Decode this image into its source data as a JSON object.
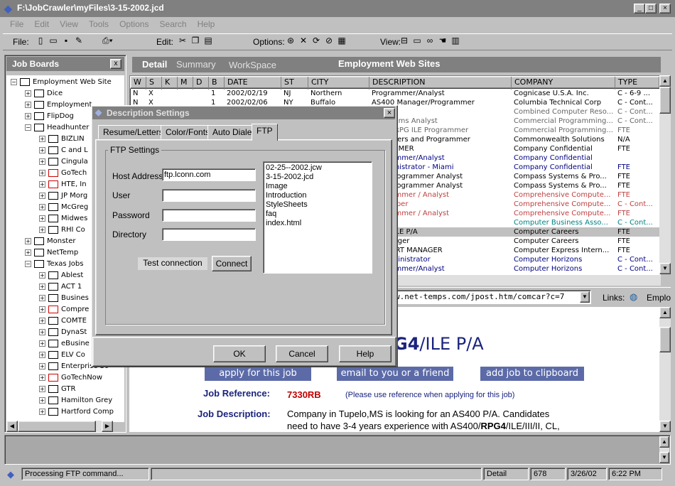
{
  "window": {
    "title": "F:\\JobCrawler\\myFiles\\3-15-2002.jcd"
  },
  "menu": [
    "File",
    "Edit",
    "View",
    "Tools",
    "Options",
    "Search",
    "Help"
  ],
  "toolbar": {
    "file": "File:",
    "edit": "Edit:",
    "options": "Options:",
    "view": "View:"
  },
  "left_panel": {
    "title": "Job Boards",
    "close": "x",
    "tree": [
      {
        "label": "Employment Web Site",
        "level": 0,
        "type": "root"
      },
      {
        "label": "Dice",
        "level": 1
      },
      {
        "label": "Employment",
        "level": 1
      },
      {
        "label": "FlipDog",
        "level": 1
      },
      {
        "label": "Headhunter",
        "level": 1
      },
      {
        "label": "BIZLIN",
        "level": 2
      },
      {
        "label": "C and L",
        "level": 2
      },
      {
        "label": "Cingula",
        "level": 2
      },
      {
        "label": "GoTech",
        "level": 2,
        "red": true
      },
      {
        "label": "HTE, In",
        "level": 2,
        "red": true
      },
      {
        "label": "JP Morg",
        "level": 2
      },
      {
        "label": "McGreg",
        "level": 2
      },
      {
        "label": "Midwes",
        "level": 2
      },
      {
        "label": "RHI Co",
        "level": 2
      },
      {
        "label": "Monster",
        "level": 1
      },
      {
        "label": "NetTemp",
        "level": 1
      },
      {
        "label": "Texas Jobs",
        "level": 1
      },
      {
        "label": "Ablest",
        "level": 2
      },
      {
        "label": "ACT 1",
        "level": 2
      },
      {
        "label": "Busines",
        "level": 2
      },
      {
        "label": "Compre",
        "level": 2,
        "red": true
      },
      {
        "label": "COMTE",
        "level": 2
      },
      {
        "label": "DynaSt",
        "level": 2
      },
      {
        "label": "eBusine",
        "level": 2
      },
      {
        "label": "ELV Co",
        "level": 2
      },
      {
        "label": "Enterprise So",
        "level": 2
      },
      {
        "label": "GoTechNow",
        "level": 2,
        "red": true
      },
      {
        "label": "GTR",
        "level": 2
      },
      {
        "label": "Hamilton Grey",
        "level": 2
      },
      {
        "label": "Hartford Comp",
        "level": 2
      }
    ]
  },
  "tabs": {
    "detail": "Detail",
    "summary": "Summary",
    "workspace": "WorkSpace",
    "section_title": "Employment Web Sites"
  },
  "grid": {
    "columns": [
      "W",
      "S",
      "K",
      "M",
      "D",
      "B",
      "DATE",
      "ST",
      "CITY",
      "DESCRIPTION",
      "COMPANY",
      "TYPE"
    ],
    "rows": [
      {
        "w": "N",
        "s": "X",
        "b": "1",
        "date": "2002/02/19",
        "st": "NJ",
        "city": "Northern",
        "desc": "Programmer/Analyst",
        "company": "Cognicase U.S.A. Inc.",
        "type": "C - 6-9 ...",
        "style": ""
      },
      {
        "w": "N",
        "s": "X",
        "b": "1",
        "date": "2002/02/06",
        "st": "NY",
        "city": "Buffalo",
        "desc": "AS400 Manager/Programmer",
        "company": "Columbia Technical Corp",
        "type": "C - Cont...",
        "style": ""
      },
      {
        "desc": "mer",
        "company": "Combined Computer Reso...",
        "type": "C - Cont...",
        "style": "gray"
      },
      {
        "desc": "B Systems Analyst",
        "company": "Commercial Programming...",
        "type": "C - Cont...",
        "style": "gray"
      },
      {
        "desc": "S/400 RPG ILE Programmer",
        "company": "Commercial Programming...",
        "type": "FTE",
        "style": "gray"
      },
      {
        "desc": "grammers and Programmer",
        "company": "Commonwealth Solutions",
        "type": "N/A",
        "style": ""
      },
      {
        "desc": "OGRAMMER",
        "company": "Company Confidential",
        "type": "FTE",
        "style": ""
      },
      {
        "desc": "Programmer/Analyst",
        "company": "Company Confidential",
        "type": "",
        "style": "blue"
      },
      {
        "desc": "r Administrator - Miami",
        "company": "Company Confidential",
        "type": "FTE",
        "style": "blue"
      },
      {
        "desc": "/400 Programmer Analyst",
        "company": "Compass Systems & Pro...",
        "type": "FTE",
        "style": ""
      },
      {
        "desc": "/400 Programmer Analyst",
        "company": "Compass Systems & Pro...",
        "type": "FTE",
        "style": ""
      },
      {
        "desc": "Programmer / Analyst",
        "company": "Comprehensive Compute...",
        "type": "FTE",
        "style": "red"
      },
      {
        "desc": "Developer",
        "company": "Comprehensive Compute...",
        "type": "C - Cont...",
        "style": "red"
      },
      {
        "desc": "Programmer / Analyst",
        "company": "Comprehensive Compute...",
        "type": "FTE",
        "style": "red"
      },
      {
        "desc": "n Lead",
        "company": "Computer Business Asso...",
        "type": "C - Cont...",
        "style": "teal"
      },
      {
        "desc": "RPG4/ILE P/A",
        "company": "Computer Careers",
        "type": "FTE",
        "style": "sel"
      },
      {
        "desc": "S Manager",
        "company": "Computer Careers",
        "type": "FTE",
        "style": ""
      },
      {
        "desc": "SUPPORT MANAGER",
        "company": "Computer Express Intern...",
        "type": "FTE",
        "style": ""
      },
      {
        "desc": "se Administrator",
        "company": "Computer Horizons",
        "type": "C - Cont...",
        "style": "blue"
      },
      {
        "desc": "Programmer/Analyst",
        "company": "Computer Horizons",
        "type": "C - Cont...",
        "style": "blue"
      }
    ]
  },
  "address": {
    "url": "w.net-temps.com/jpost.htm/comcar?c=7",
    "links": "Links:",
    "emplo": "Emplo"
  },
  "web": {
    "heading_bold": "G4",
    "heading_rest": "/ILE P/A",
    "apply": "apply for this job",
    "email": "email to you or a friend",
    "clip": "add job to clipboard",
    "ref_label": "Job Reference:",
    "ref_value": "7330RB",
    "ref_note": "(Please use reference when applying for this job)",
    "desc_label": "Job Description:",
    "desc_line1": "Company in Tupelo,MS is looking for an AS400 P/A. Candidates",
    "desc_line2a": "need to have 3-4 years experience with AS400/",
    "desc_line2b": "RPG4",
    "desc_line2c": "/ILE/III/II, CL,"
  },
  "dialog": {
    "title": "Description Settings",
    "tabs": [
      "Resume/Letters",
      "Color/Fonts",
      "Auto Dialer",
      "FTP"
    ],
    "group": "FTP Settings",
    "host_label": "Host Address",
    "host_value": "ftp.lconn.com",
    "user_label": "User",
    "password_label": "Password",
    "directory_label": "Directory",
    "files": [
      "02-25--2002.jcw",
      "3-15-2002.jcd",
      "Image",
      "Introduction",
      "StyleSheets",
      "faq",
      "index.html"
    ],
    "test": "Test connection",
    "connect": "Connect",
    "ok": "OK",
    "cancel": "Cancel",
    "help": "Help"
  },
  "status": {
    "message": "Processing FTP command...",
    "view": "Detail",
    "count": "678",
    "date": "3/26/02",
    "time": "6:22 PM"
  }
}
